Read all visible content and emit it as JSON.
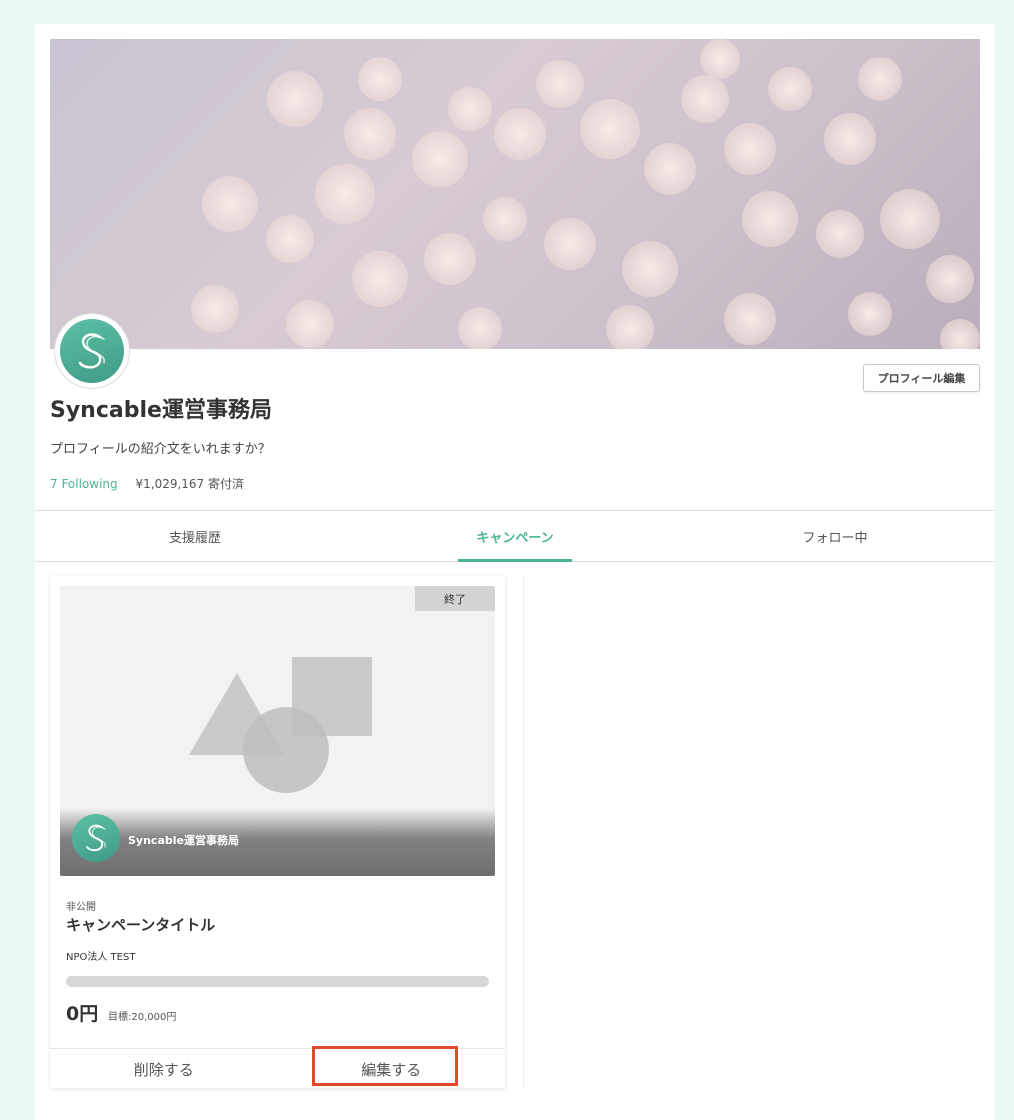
{
  "profile": {
    "name": "Syncable運営事務局",
    "bio": "プロフィールの紹介文をいれますか？",
    "following": "7 Following",
    "donated": "¥1,029,167 寄付済",
    "edit_button": "プロフィール編集"
  },
  "tabs": [
    {
      "label": "支援履歴"
    },
    {
      "label": "キャンペーン"
    },
    {
      "label": "フォロー中"
    }
  ],
  "card": {
    "badge": "終了",
    "org_overlay": "Syncable運営事務局",
    "status": "非公開",
    "title": "キャンペーンタイトル",
    "organization": "NPO法人 TEST",
    "raised": "0円",
    "goal": "目標:20,000円",
    "progress": 0,
    "delete_label": "削除する",
    "edit_label": "編集する"
  },
  "colors": {
    "accent": "#49b595",
    "background": "#eaf7f3",
    "highlight": "#e04a2a"
  },
  "icons": {
    "avatar": "syncable-logo-icon",
    "placeholder": "image-placeholder-icon"
  }
}
